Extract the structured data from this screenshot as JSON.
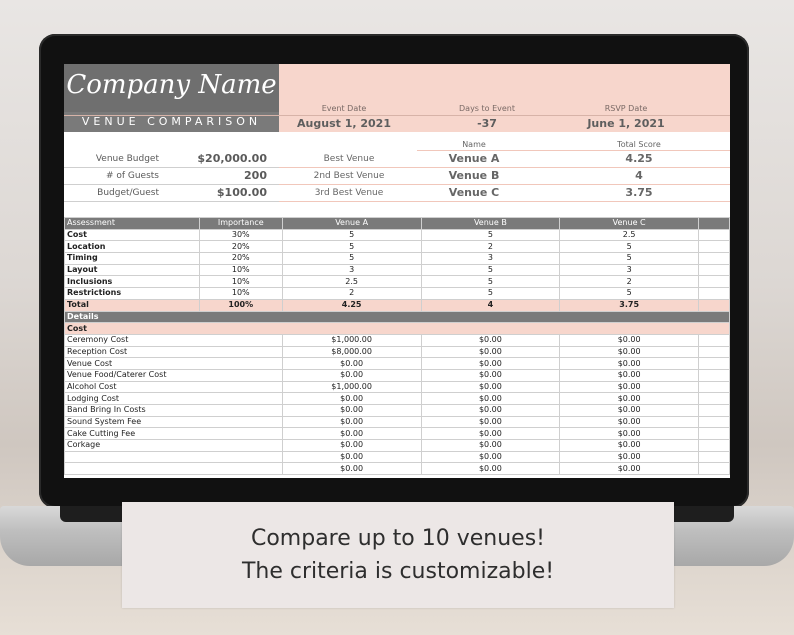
{
  "header": {
    "company_name": "Company Name",
    "subtitle": "VENUE COMPARISON",
    "event_date_label": "Event Date",
    "event_date": "August 1, 2021",
    "days_label": "Days to Event",
    "days": "-37",
    "rsvp_label": "RSVP Date",
    "rsvp": "June 1, 2021",
    "name_label": "Name",
    "score_label": "Total Score"
  },
  "info": [
    {
      "label": "Venue Budget",
      "value": "$20,000.00"
    },
    {
      "label": "# of Guests",
      "value": "200"
    },
    {
      "label": "Budget/Guest",
      "value": "$100.00"
    }
  ],
  "ranking": [
    {
      "label": "Best Venue",
      "name": "Venue A",
      "score": "4.25"
    },
    {
      "label": "2nd Best Venue",
      "name": "Venue B",
      "score": "4"
    },
    {
      "label": "3rd Best Venue",
      "name": "Venue C",
      "score": "3.75"
    }
  ],
  "assessment": {
    "headers": [
      "Assessment",
      "Importance",
      "Venue A",
      "Venue B",
      "Venue C"
    ],
    "rows": [
      {
        "name": "Cost",
        "importance": "30%",
        "a": "5",
        "b": "5",
        "c": "2.5"
      },
      {
        "name": "Location",
        "importance": "20%",
        "a": "5",
        "b": "2",
        "c": "5"
      },
      {
        "name": "Timing",
        "importance": "20%",
        "a": "5",
        "b": "3",
        "c": "5"
      },
      {
        "name": "Layout",
        "importance": "10%",
        "a": "3",
        "b": "5",
        "c": "3"
      },
      {
        "name": "Inclusions",
        "importance": "10%",
        "a": "2.5",
        "b": "5",
        "c": "2"
      },
      {
        "name": "Restrictions",
        "importance": "10%",
        "a": "2",
        "b": "5",
        "c": "5"
      }
    ],
    "total": {
      "name": "Total",
      "importance": "100%",
      "a": "4.25",
      "b": "4",
      "c": "3.75"
    }
  },
  "details": {
    "section_label": "Details",
    "cost_label": "Cost",
    "rows": [
      {
        "name": "Ceremony Cost",
        "a": "$1,000.00",
        "b": "$0.00",
        "c": "$0.00"
      },
      {
        "name": "Reception Cost",
        "a": "$8,000.00",
        "b": "$0.00",
        "c": "$0.00"
      },
      {
        "name": "Venue Cost",
        "a": "$0.00",
        "b": "$0.00",
        "c": "$0.00"
      },
      {
        "name": "Venue Food/Caterer Cost",
        "a": "$0.00",
        "b": "$0.00",
        "c": "$0.00"
      },
      {
        "name": "Alcohol Cost",
        "a": "$1,000.00",
        "b": "$0.00",
        "c": "$0.00"
      },
      {
        "name": "Lodging Cost",
        "a": "$0.00",
        "b": "$0.00",
        "c": "$0.00"
      },
      {
        "name": "Band Bring In Costs",
        "a": "$0.00",
        "b": "$0.00",
        "c": "$0.00"
      },
      {
        "name": "Sound System Fee",
        "a": "$0.00",
        "b": "$0.00",
        "c": "$0.00"
      },
      {
        "name": "Cake Cutting Fee",
        "a": "$0.00",
        "b": "$0.00",
        "c": "$0.00"
      },
      {
        "name": "Corkage",
        "a": "$0.00",
        "b": "$0.00",
        "c": "$0.00"
      },
      {
        "name": "",
        "a": "$0.00",
        "b": "$0.00",
        "c": "$0.00"
      },
      {
        "name": "",
        "a": "$0.00",
        "b": "$0.00",
        "c": "$0.00"
      }
    ]
  },
  "caption": {
    "line1": "Compare up to 10 venues!",
    "line2": "The criteria is customizable!"
  },
  "colors": {
    "accent_pink": "#f7d6cc",
    "header_gray": "#6f6f6f"
  }
}
